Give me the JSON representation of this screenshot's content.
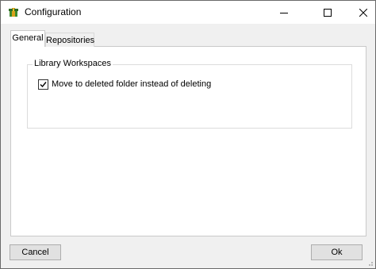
{
  "window": {
    "title": "Configuration",
    "controls": {
      "minimize": "minimize-icon",
      "maximize": "maximize-icon",
      "close": "close-icon"
    }
  },
  "tabs": [
    {
      "label": "General",
      "selected": true
    },
    {
      "label": "Repositories",
      "selected": false
    }
  ],
  "general": {
    "group_title": "Library Workspaces",
    "checkbox": {
      "label": "Move to deleted folder instead of deleting",
      "checked": true
    }
  },
  "buttons": {
    "cancel": "Cancel",
    "ok": "Ok"
  },
  "colors": {
    "app_icon_green": "#3c8a2e",
    "app_icon_gold": "#d9a21b"
  }
}
